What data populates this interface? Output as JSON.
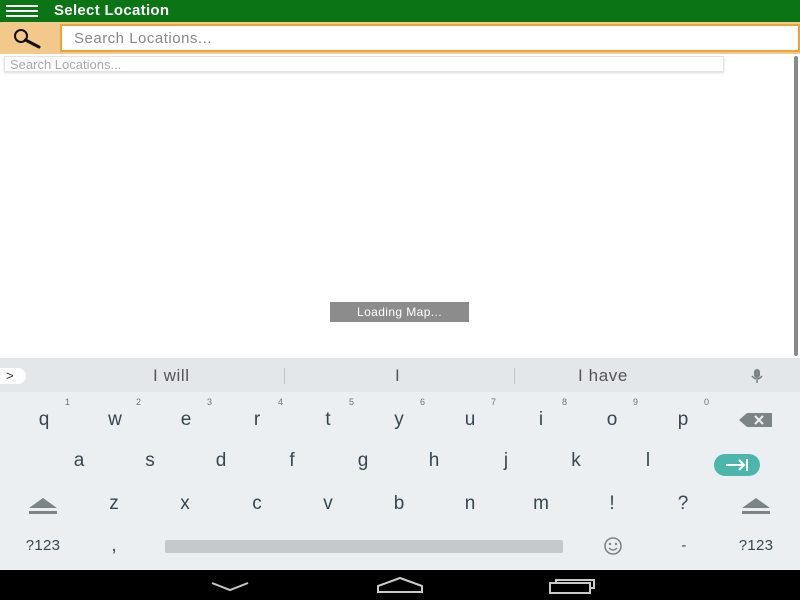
{
  "app": {
    "title": "Select Location",
    "colors": {
      "appbar": "#0b7414",
      "searchbar": "#f2c98a",
      "input_border": "#f0a33a",
      "enter_key": "#4db6ac"
    }
  },
  "search": {
    "placeholder": "Search Locations...",
    "value": "",
    "suggestion_placeholder": "Search Locations..."
  },
  "map": {
    "status": "Loading Map..."
  },
  "keyboard": {
    "suggestions": [
      "I will",
      "I",
      "I have"
    ],
    "row1": [
      {
        "k": "q",
        "hint": "1"
      },
      {
        "k": "w",
        "hint": "2"
      },
      {
        "k": "e",
        "hint": "3"
      },
      {
        "k": "r",
        "hint": "4"
      },
      {
        "k": "t",
        "hint": "5"
      },
      {
        "k": "y",
        "hint": "6"
      },
      {
        "k": "u",
        "hint": "7"
      },
      {
        "k": "i",
        "hint": "8"
      },
      {
        "k": "o",
        "hint": "9"
      },
      {
        "k": "p",
        "hint": "0"
      }
    ],
    "row2": [
      "a",
      "s",
      "d",
      "f",
      "g",
      "h",
      "j",
      "k",
      "l"
    ],
    "row3": [
      "z",
      "x",
      "c",
      "v",
      "b",
      "n",
      "m",
      "!",
      "?"
    ],
    "mode_label": "?123",
    "comma": ",",
    "dash": "-",
    "strip_arrow": ">"
  },
  "icons": [
    "menu-icon",
    "search-icon",
    "mic-icon",
    "backspace-icon",
    "enter-icon",
    "shift-icon",
    "emoji-icon",
    "back-icon",
    "home-icon",
    "recents-icon"
  ]
}
